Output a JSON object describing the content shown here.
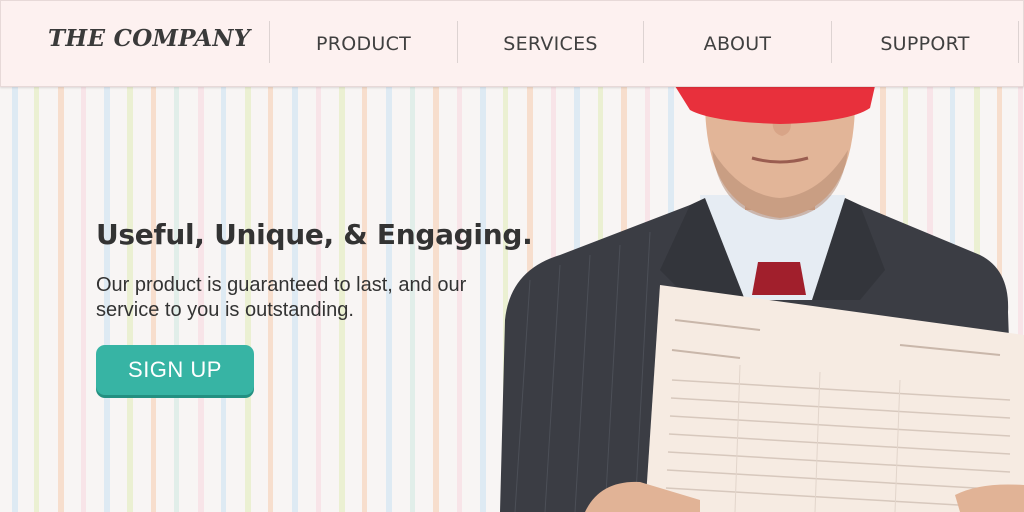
{
  "header": {
    "logo": "THE COMPANY",
    "nav": [
      {
        "label": "PRODUCT"
      },
      {
        "label": "SERVICES"
      },
      {
        "label": "ABOUT"
      },
      {
        "label": "SUPPORT"
      }
    ]
  },
  "hero": {
    "headline": "Useful, Unique, & Engaging.",
    "subtext": "Our product is guaranteed to last, and our service to you is outstanding.",
    "cta_label": "SIGN UP"
  },
  "colors": {
    "header_bg": "#fdf1f0",
    "cta_bg": "#37b4a4",
    "text": "#333333",
    "blindfold": "#e8303c"
  }
}
